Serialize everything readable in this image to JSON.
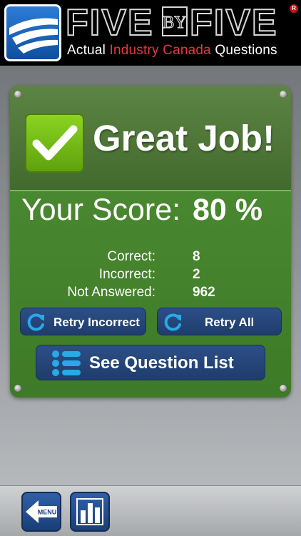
{
  "header": {
    "brand_left": "FIVE",
    "brand_mid": "BY",
    "brand_right": "FIVE",
    "registered_mark": "R",
    "tagline_prefix": "Actual ",
    "tagline_highlight": "Industry Canada",
    "tagline_suffix": " Questions",
    "logo_icon": "wing-logo-icon"
  },
  "result": {
    "heading": "Great Job!",
    "heading_icon": "checkmark-icon",
    "score_label": "Your Score:",
    "score_value": "80 %",
    "stats": [
      {
        "label": "Correct:",
        "value": "8"
      },
      {
        "label": "Incorrect:",
        "value": "2"
      },
      {
        "label": "Not Answered:",
        "value": "962"
      }
    ]
  },
  "actions": {
    "retry_incorrect": "Retry Incorrect",
    "retry_all": "Retry All",
    "see_question_list": "See Question List",
    "retry_icon": "refresh-icon",
    "list_icon": "list-icon"
  },
  "toolbar": {
    "menu_label": "MENU",
    "menu_icon": "back-arrow-icon",
    "stats_icon": "bar-chart-icon"
  },
  "colors": {
    "panel_green": "#4e8f34",
    "check_green": "#7bc61c",
    "button_blue": "#24467a",
    "accent_red": "#e23a3a",
    "icon_cyan": "#29a9e8"
  }
}
